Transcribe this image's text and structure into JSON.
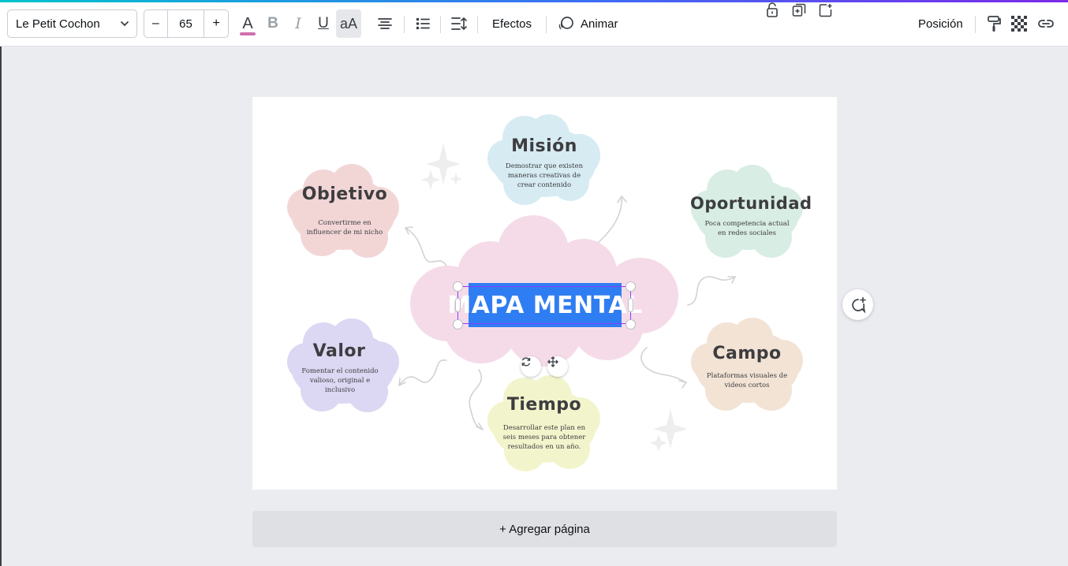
{
  "toolbar": {
    "font_name": "Le Petit Cochon",
    "font_size": "65",
    "minus_label": "–",
    "plus_label": "+",
    "color_label": "A",
    "bold_label": "B",
    "italic_label": "I",
    "underline_label": "U",
    "case_label": "aA",
    "effects_label": "Efectos",
    "animate_label": "Animar",
    "position_label": "Posición",
    "text_color_hex": "#d06fb0"
  },
  "canvas": {
    "central_title": "MAPA MENTAL",
    "nodes": [
      {
        "title": "Misión",
        "lines": [
          "Demostrar que existen",
          "maneras creativas de",
          "crear contenido"
        ],
        "color": "#d6ebf2"
      },
      {
        "title": "Objetivo",
        "lines": [
          "Convertirme en",
          "influencer de mi nicho"
        ],
        "color": "#f2d6d6"
      },
      {
        "title": "Oportunidad",
        "lines": [
          "Poca competencia actual",
          "en redes sociales"
        ],
        "color": "#d8ede3"
      },
      {
        "title": "Valor",
        "lines": [
          "Fomentar el contenido",
          "valioso, original e",
          "inclusivo"
        ],
        "color": "#dcd7f2"
      },
      {
        "title": "Campo",
        "lines": [
          "Plataformas visuales de",
          "videos cortos"
        ],
        "color": "#f2e3d4"
      },
      {
        "title": "Tiempo",
        "lines": [
          "Desarrollar este plan en",
          "seis meses para obtener",
          "resultados en un año."
        ],
        "color": "#f2f5cc"
      }
    ],
    "center_cloud_color": "#f5dbe8",
    "selection_color": "#2f7df3"
  },
  "footer": {
    "add_page_label": "+ Agregar página"
  },
  "icons": {
    "font_dropdown": "chevron-down-icon",
    "align": "align-center-icon",
    "list": "bulleted-list-icon",
    "spacing": "spacing-icon",
    "animate": "animate-icon",
    "paint": "paint-roller-icon",
    "transparency": "transparency-icon",
    "link": "link-icon",
    "lock": "lock-icon",
    "duplicate": "duplicate-icon",
    "add_page": "add-page-icon",
    "rotate": "rotate-icon",
    "move": "move-icon",
    "assistant": "magic-comment-icon"
  }
}
